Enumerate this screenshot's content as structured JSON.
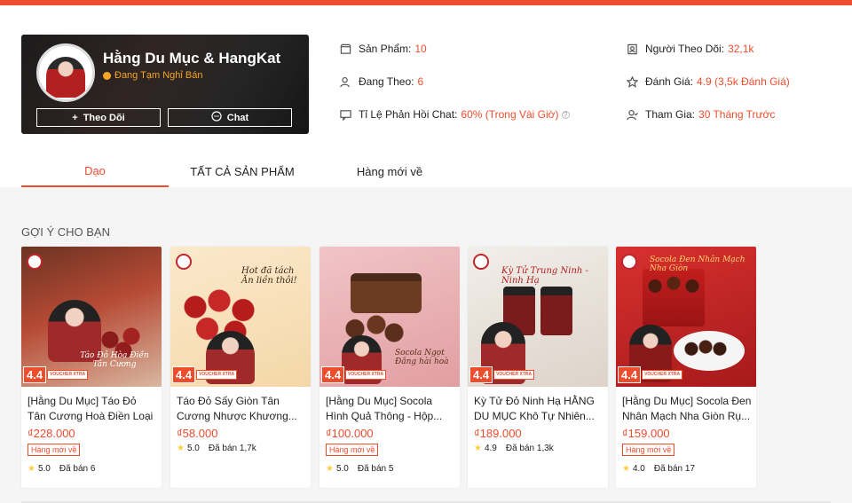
{
  "colors": {
    "accent": "#ee4d2d",
    "rating_star": "#ffce3d"
  },
  "shop": {
    "name": "Hằng Du Mục & HangKat",
    "status": "Đang Tạm Nghỉ Bán",
    "follow_label": "Theo Dõi",
    "chat_label": "Chat"
  },
  "stats": {
    "products_label": "Sản Phẩm:",
    "products_value": "10",
    "following_label": "Đang Theo:",
    "following_value": "6",
    "chat_rate_label": "Tỉ Lệ Phản Hồi Chat:",
    "chat_rate_value": "60% (Trong Vài Giờ)",
    "followers_label": "Người Theo Dõi:",
    "followers_value": "32,1k",
    "rating_label": "Đánh Giá:",
    "rating_value": "4.9 (3,5k Đánh Giá)",
    "joined_label": "Tham Gia:",
    "joined_value": "30 Tháng Trước"
  },
  "tabs": [
    {
      "label": "Dạo",
      "active": true
    },
    {
      "label": "TẤT CẢ SẢN PHẨM",
      "active": false
    },
    {
      "label": "Hàng mới về",
      "active": false
    }
  ],
  "section_title": "GỢI Ý CHO BẠN",
  "products": [
    {
      "title": "[Hằng Du Mục] Táo Đỏ Tân Cương Hoà Điền Loại Si...",
      "price": "₫228.000",
      "new_badge": "Hàng mới về",
      "rating": "5.0",
      "sold": "Đã bán 6",
      "voucher": "4.4",
      "voucher_label": "VOUCHER XTRA",
      "image_text": "Táo Đỏ Hòa Điền Tân Cương",
      "image_bg": "#c9473a"
    },
    {
      "title": "Táo Đỏ Sấy Giòn Tân Cương Nhược Khương...",
      "price": "₫58.000",
      "new_badge": "",
      "rating": "5.0",
      "sold": "Đã bán 1,7k",
      "voucher": "4.4",
      "voucher_label": "VOUCHER XTRA",
      "image_text": "Hot đã tách Ăn liền thôi!",
      "image_bg": "#f7e6c4"
    },
    {
      "title": "[Hằng Du Mục] Socola Hình Quả Thông - Hộp...",
      "price": "₫100.000",
      "new_badge": "Hàng mới về",
      "rating": "5.0",
      "sold": "Đã bán 5",
      "voucher": "4.4",
      "voucher_label": "VOUCHER XTRA",
      "image_text": "Socola Ngọt Đắng hài hoà",
      "image_bg": "#e9b3b5"
    },
    {
      "title": "Kỳ Tử Đỏ Ninh Hạ HẰNG DU MỤC Khô Tự Nhiên...",
      "price": "₫189.000",
      "new_badge": "",
      "rating": "4.9",
      "sold": "Đã bán 1,3k",
      "voucher": "4.4",
      "voucher_label": "VOUCHER XTRA",
      "image_text": "Kỳ Tử Trung Ninh - Ninh Hạ",
      "image_bg": "#e8e2dc"
    },
    {
      "title": "[Hằng Du Mục] Socola Đen Nhân Mạch Nha Giòn Rụ...",
      "price": "₫159.000",
      "new_badge": "Hàng mới về",
      "rating": "4.0",
      "sold": "Đã bán 17",
      "voucher": "4.4",
      "voucher_label": "VOUCHER XTRA",
      "image_text": "Socola Đen Nhân Mạch Nha Giòn",
      "image_bg": "#c92424"
    }
  ]
}
